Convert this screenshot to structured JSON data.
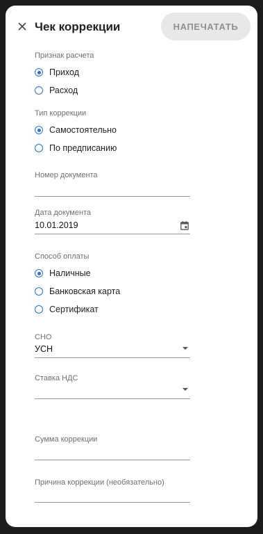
{
  "header": {
    "title": "Чек коррекции",
    "print_label": "НАПЕЧАТАТЬ"
  },
  "settlement": {
    "label": "Признак расчета",
    "options": [
      {
        "label": "Приход",
        "checked": true
      },
      {
        "label": "Расход",
        "checked": false
      }
    ]
  },
  "correction_type": {
    "label": "Тип коррекции",
    "options": [
      {
        "label": "Самостоятельно",
        "checked": true
      },
      {
        "label": "По предписанию",
        "checked": false
      }
    ]
  },
  "doc_number": {
    "label": "Номер документа",
    "value": ""
  },
  "doc_date": {
    "label": "Дата документа",
    "value": "10.01.2019"
  },
  "payment_method": {
    "label": "Способ оплаты",
    "options": [
      {
        "label": "Наличные",
        "checked": true
      },
      {
        "label": "Банковская карта",
        "checked": false
      },
      {
        "label": "Сертификат",
        "checked": false
      }
    ]
  },
  "sno": {
    "label": "СНО",
    "value": "УСН"
  },
  "vat_rate": {
    "label": "Ставка НДС",
    "value": ""
  },
  "correction_sum": {
    "label": "Сумма коррекции",
    "value": ""
  },
  "correction_reason": {
    "label": "Причина коррекции (необязательно)",
    "value": ""
  },
  "colors": {
    "accent": "#2a73c8",
    "disabled_button": "#e8e8e8"
  },
  "icons": [
    "close-icon",
    "calendar-icon",
    "dropdown-arrow-icon"
  ]
}
